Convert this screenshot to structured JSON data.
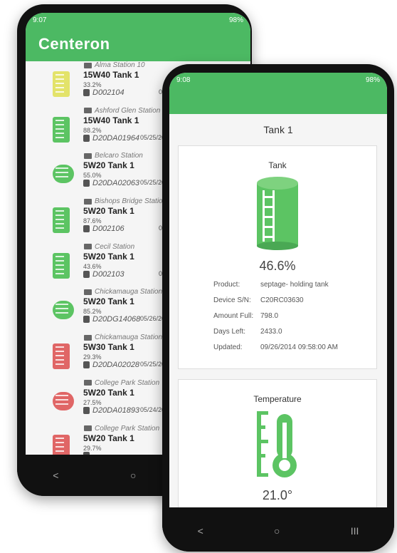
{
  "back": {
    "status_time": "9:07",
    "status_battery": "98%",
    "brand": "Centeron",
    "items": [
      {
        "station": "Alma Station 10",
        "name": "15W40 Tank 1",
        "pct": "33.2%",
        "device": "D002104",
        "date": "05/23/2022",
        "color": "#e3e36a",
        "shape": "vert"
      },
      {
        "station": "Ashford Glen Station",
        "name": "15W40 Tank 1",
        "pct": "88.2%",
        "device": "D20DA01964",
        "date": "05/25/2022",
        "color": "#5cc463",
        "shape": "vert"
      },
      {
        "station": "Belcaro Station",
        "name": "5W20 Tank 1",
        "pct": "55.0%",
        "device": "D20DA02063",
        "date": "05/25/2022",
        "color": "#5cc463",
        "shape": "horiz"
      },
      {
        "station": "Bishops Bridge Station",
        "name": "5W20 Tank 1",
        "pct": "87.6%",
        "device": "D002106",
        "date": "05/25/2022",
        "color": "#5cc463",
        "shape": "vert"
      },
      {
        "station": "Cecil Station",
        "name": "5W20 Tank 1",
        "pct": "43.6%",
        "device": "D002103",
        "date": "05/23/2022",
        "color": "#5cc463",
        "shape": "vert"
      },
      {
        "station": "Chickamauga Station",
        "name": "5W20 Tank 1",
        "pct": "85.2%",
        "device": "D20DG14068",
        "date": "05/26/2022",
        "color": "#5cc463",
        "shape": "horiz"
      },
      {
        "station": "Chickamauga Station",
        "name": "5W30 Tank 1",
        "pct": "29.3%",
        "device": "D20DA02028",
        "date": "05/25/2022",
        "color": "#e06666",
        "shape": "vert"
      },
      {
        "station": "College Park Station",
        "name": "5W20 Tank 1",
        "pct": "27.5%",
        "device": "D20DA01893",
        "date": "05/24/2022",
        "color": "#e06666",
        "shape": "horiz"
      },
      {
        "station": "College Park Station",
        "name": "5W20 Tank 1",
        "pct": "29.7%",
        "device": "",
        "date": "",
        "color": "#e06666",
        "shape": "vert"
      }
    ]
  },
  "front": {
    "status_time": "9:08",
    "status_battery": "98%",
    "page_title": "Tank 1",
    "tank_card": {
      "title": "Tank",
      "value": "46.6%",
      "fill_fraction": 0.466,
      "rows": [
        {
          "key": "Product:",
          "val": "septage- holding tank"
        },
        {
          "key": "Device S/N:",
          "val": "C20RC03630"
        },
        {
          "key": "Amount Full:",
          "val": "798.0"
        },
        {
          "key": "Days Left:",
          "val": "2433.0"
        },
        {
          "key": "Updated:",
          "val": "09/26/2014 09:58:00 AM"
        }
      ]
    },
    "temp_card": {
      "title": "Temperature",
      "value": "21.0°"
    }
  },
  "nav": {
    "back": "<",
    "home": "○",
    "recent": "III"
  },
  "colors": {
    "accent": "#4cb963",
    "tank_green": "#5cc463"
  }
}
